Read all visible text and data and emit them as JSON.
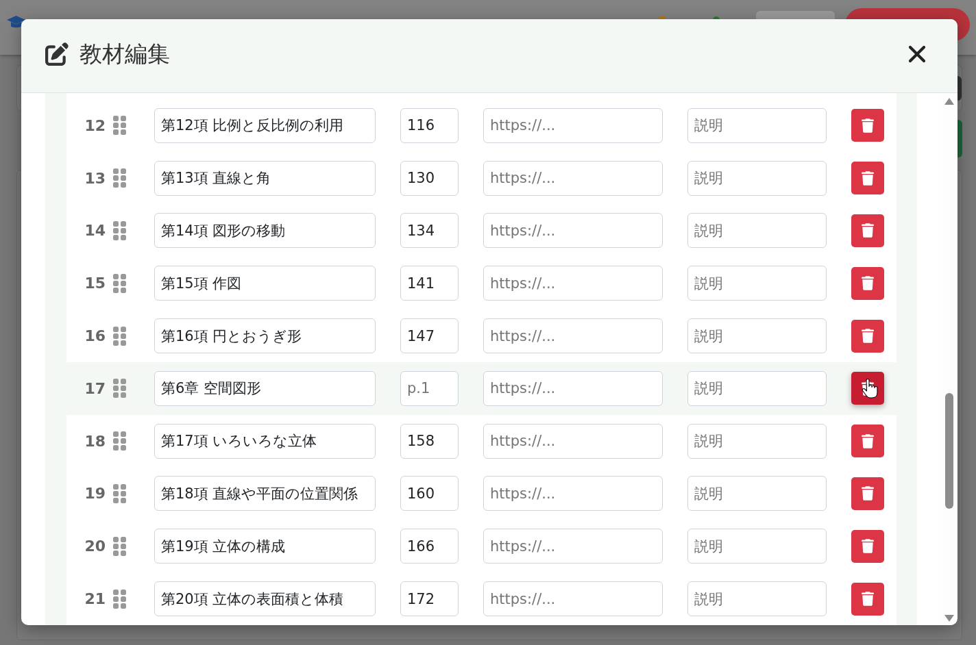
{
  "dialog": {
    "title": "教材編集"
  },
  "rows": [
    {
      "number": "12",
      "title": "第12項 比例と反比例の利用",
      "page": {
        "value": "116"
      },
      "url": {
        "placeholder": "https://..."
      },
      "description": {
        "placeholder": "説明"
      },
      "hovered": false
    },
    {
      "number": "13",
      "title": "第13項 直線と角",
      "page": {
        "value": "130"
      },
      "url": {
        "placeholder": "https://..."
      },
      "description": {
        "placeholder": "説明"
      },
      "hovered": false
    },
    {
      "number": "14",
      "title": "第14項 図形の移動",
      "page": {
        "value": "134"
      },
      "url": {
        "placeholder": "https://..."
      },
      "description": {
        "placeholder": "説明"
      },
      "hovered": false
    },
    {
      "number": "15",
      "title": "第15項 作図",
      "page": {
        "value": "141"
      },
      "url": {
        "placeholder": "https://..."
      },
      "description": {
        "placeholder": "説明"
      },
      "hovered": false
    },
    {
      "number": "16",
      "title": "第16項 円とおうぎ形",
      "page": {
        "value": "147"
      },
      "url": {
        "placeholder": "https://..."
      },
      "description": {
        "placeholder": "説明"
      },
      "hovered": false
    },
    {
      "number": "17",
      "title": "第6章 空間図形",
      "page": {
        "placeholder": "p.1"
      },
      "url": {
        "placeholder": "https://..."
      },
      "description": {
        "placeholder": "説明"
      },
      "hovered": true
    },
    {
      "number": "18",
      "title": "第17項 いろいろな立体",
      "page": {
        "value": "158"
      },
      "url": {
        "placeholder": "https://..."
      },
      "description": {
        "placeholder": "説明"
      },
      "hovered": false
    },
    {
      "number": "19",
      "title": "第18項 直線や平面の位置関係",
      "page": {
        "value": "160"
      },
      "url": {
        "placeholder": "https://..."
      },
      "description": {
        "placeholder": "説明"
      },
      "hovered": false
    },
    {
      "number": "20",
      "title": "第19項 立体の構成",
      "page": {
        "value": "166"
      },
      "url": {
        "placeholder": "https://..."
      },
      "description": {
        "placeholder": "説明"
      },
      "hovered": false
    },
    {
      "number": "21",
      "title": "第20項 立体の表面積と体積",
      "page": {
        "value": "172"
      },
      "url": {
        "placeholder": "https://..."
      },
      "description": {
        "placeholder": "説明"
      },
      "hovered": false
    }
  ]
}
